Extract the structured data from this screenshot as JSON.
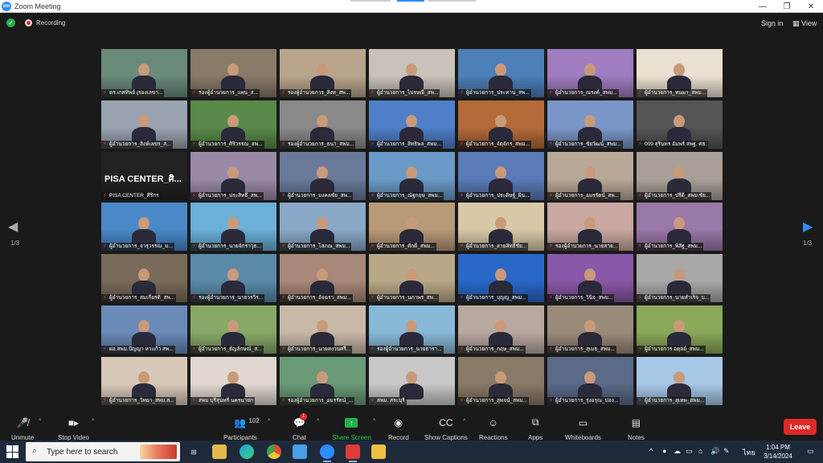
{
  "window": {
    "title": "Zoom Meeting",
    "app_icon_text": "zm",
    "controls": [
      "—",
      "❐",
      "✕"
    ]
  },
  "infobar": {
    "recording_label": "Recording",
    "sign_in_label": "Sign in",
    "view_label": "View"
  },
  "pagination": {
    "left_page": "1/3",
    "right_page": "1/3"
  },
  "tiles": [
    {
      "label": "ดร.เกศทิพย์ (รองเลขา...",
      "bg": "#6a8a7a",
      "active": true
    },
    {
      "label": "รองผู้อำนวยการ_แผน_ส...",
      "bg": "#8a7a6a"
    },
    {
      "label": "รองผู้อำนวยการ_สิงห_สพ...",
      "bg": "#b9a58c"
    },
    {
      "label": "ผู้อำนวยการ_ไปรษณี_สพ...",
      "bg": "#c8c2b8"
    },
    {
      "label": "ผู้อำนวยการ_ประทาน_สพ...",
      "bg": "#4d7fb8"
    },
    {
      "label": "ผู้อำนวยการ_ณรงค์_สพม...",
      "bg": "#a07cc0"
    },
    {
      "label": "ผู้อำนวยการ_ทนมา_สพม...",
      "bg": "#e8e0d0"
    },
    {
      "label": "ผู้อำนวยการ_สิงห์เลขร_ส...",
      "bg": "#9aa4b0"
    },
    {
      "label": "ผู้อำนวยการ_ศิริวรรณ_สพ...",
      "bg": "#5a8a4a"
    },
    {
      "label": "รองผู้อำนวยการ_ธนา_สพม...",
      "bg": "#8a8a8a"
    },
    {
      "label": "ผู้อำนวยการ_สิทธิพล_สพม...",
      "bg": "#4f7fc8"
    },
    {
      "label": "ผู้อำนวยการ_จัตุจักร_สพม...",
      "bg": "#b56a3a"
    },
    {
      "label": "ผู้อำนวยการ_ชัยวัฒน์_สพม...",
      "bg": "#7a96c8"
    },
    {
      "label": "009 สุรินทร อัมพร์ สพฐ. ศธ.",
      "bg": "#555"
    },
    {
      "label": "PISA CENTER_ศิริกร",
      "bg": "#222",
      "big_text": "PISA CENTER_ศิ..."
    },
    {
      "label": "ผู้อำนวยการ_ประสิทธิ์_สพ...",
      "bg": "#9a8aa8"
    },
    {
      "label": "ผู้อำนวยการ_มงคลชัย_สพ...",
      "bg": "#6a7a9a"
    },
    {
      "label": "ผู้อำนวยการ_ณัฐกฤษ_สพม...",
      "bg": "#6a9ac8"
    },
    {
      "label": "ผู้อำนวยการ_ประดิษฐ์_ผิน...",
      "bg": "#5a7ab8"
    },
    {
      "label": "ผู้อำนวยการ_อมรรัตน์_สพ...",
      "bg": "#b8a898"
    },
    {
      "label": "ผู้อำนวยการ_ปรีดี_สพม.ชัย...",
      "bg": "#a8a098"
    },
    {
      "label": "ผู้อำนวยการ_จารุวรรณ_ม...",
      "bg": "#4a88c8"
    },
    {
      "label": "ผู้อำนวยการ_นายจักราวุธ...",
      "bg": "#6ab0d8"
    },
    {
      "label": "ผู้อำนวยการ_โสภณ_สพม...",
      "bg": "#8aa8c8"
    },
    {
      "label": "ผู้อำนวยการ_ศักดิ์_สพม...",
      "bg": "#b89a78"
    },
    {
      "label": "ผู้อำนวยการ_สายสิทธิ์ชัย...",
      "bg": "#d8c8a8"
    },
    {
      "label": "รองผู้อำนวยการ_นายสาย...",
      "bg": "#c8a8a0"
    },
    {
      "label": "ผู้อำนวยการ_พิสิฐ_สพม...",
      "bg": "#9a78a8"
    },
    {
      "label": "ผู้อำนวยการ_สมเกียรติ_สพ...",
      "bg": "#7a6a5a"
    },
    {
      "label": "รองผู้อำนวยการ_นายวรวิร...",
      "bg": "#5a8aa8"
    },
    {
      "label": "ผู้อำนวยการ_อัจฉรา_สพม...",
      "bg": "#a88878"
    },
    {
      "label": "ผู้อำนวยการ_นภาพร_สพ...",
      "bg": "#b8a888"
    },
    {
      "label": "ผู้อำนวยการ_บุญญ_สพม...",
      "bg": "#2a68c8"
    },
    {
      "label": "ผู้อำนวยการ_วินิจ_สพม...",
      "bg": "#8a58a8"
    },
    {
      "label": "ผู้อำนวยการ_นายสำเร็จ_บ...",
      "bg": "#a8a8a8"
    },
    {
      "label": "ผอ.สพม.ปัญญา หาแก้ว สพ...",
      "bg": "#6a8ab8"
    },
    {
      "label": "ผู้อำนวยการ_ธัญลักษณ์_ส...",
      "bg": "#88a868"
    },
    {
      "label": "ผู้อำนวยการ_นายสงวนศรี...",
      "bg": "#c8b8a8"
    },
    {
      "label": "รองผู้อำนวยการ_นายธารา...",
      "bg": "#88b8d8"
    },
    {
      "label": "ผู้อำนวยการ_กฤษ_สพม...",
      "bg": "#b8a8a0"
    },
    {
      "label": "ผู้อำนวยการ_สุเมธ_สพม...",
      "bg": "#9a8a7a"
    },
    {
      "label": "ผู้อำนวยการ อดุลย์_สพม...",
      "bg": "#8aa858"
    },
    {
      "label": "ผู้อำนวยการ_วิทยา_สพม.ส...",
      "bg": "#d8c8b8"
    },
    {
      "label": "สพม บุรีสุนทรี นครนายก",
      "bg": "#e0d8d0"
    },
    {
      "label": "รองผู้อำนวยการ_อมรรัตน์_...",
      "bg": "#6a9a78"
    },
    {
      "label": "สพม. สระบุรี",
      "bg": "#c8c8c8"
    },
    {
      "label": "ผู้อำนวยการ_สุพจน์_สพม...",
      "bg": "#8a7a68"
    },
    {
      "label": "ผู้อำนวยการ_รุ่งอรุณ_บ่อง...",
      "bg": "#5a6a88"
    },
    {
      "label": "ผู้อำนวยการ_สุเทพ_สพม...",
      "bg": "#a8c8e8"
    }
  ],
  "toolbar": {
    "unmute": "Unmute",
    "stop_video": "Stop Video",
    "participants": "Participants",
    "participants_count": "102",
    "chat": "Chat",
    "chat_badge": "1",
    "share_screen": "Share Screen",
    "record": "Record",
    "show_captions": "Show Captions",
    "reactions": "Reactions",
    "apps": "Apps",
    "whiteboards": "Whiteboards",
    "notes": "Notes",
    "leave": "Leave"
  },
  "taskbar": {
    "search_placeholder": "Type here to search",
    "lang": "ไทย",
    "time": "1:04 PM",
    "date": "3/14/2024"
  }
}
